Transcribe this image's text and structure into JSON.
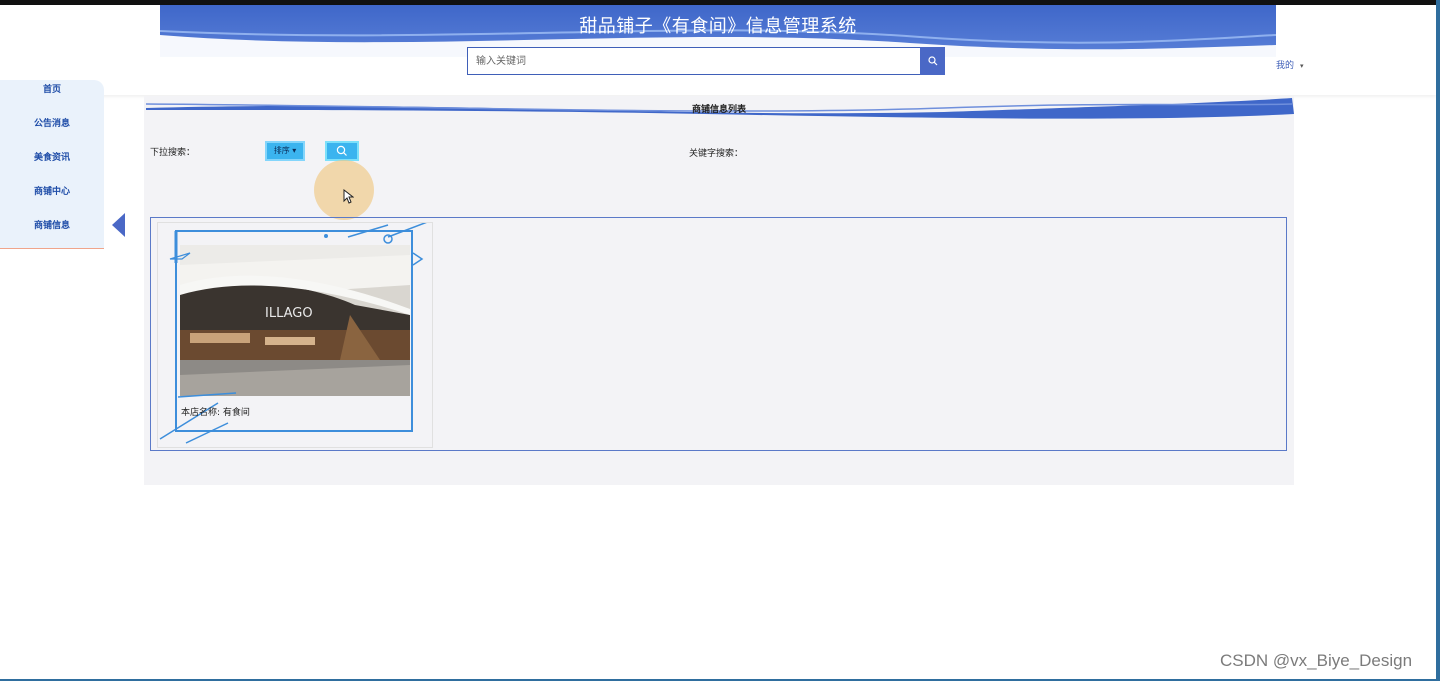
{
  "header": {
    "title": "甜品铺子《有食间》信息管理系统",
    "search_placeholder": "输入关键词",
    "user_menu_label": "我的"
  },
  "sidebar": {
    "items": [
      {
        "label": "首页"
      },
      {
        "label": "公告消息"
      },
      {
        "label": "美食资讯"
      },
      {
        "label": "商铺中心"
      },
      {
        "label": "商铺信息"
      }
    ]
  },
  "main": {
    "list_title": "商铺信息列表",
    "filter_label": "下拉搜索：",
    "sort_label": "排序",
    "keyword_label": "关键字搜索："
  },
  "shops": [
    {
      "name_label": "本店名称",
      "name_value": "有食间",
      "sign_text": "ILLAGO"
    }
  ],
  "watermark": "CSDN @vx_Biye_Design",
  "colors": {
    "primary": "#4a68c6",
    "accent": "#3bb4ef",
    "sidebar_bg": "#eaf2fb"
  }
}
